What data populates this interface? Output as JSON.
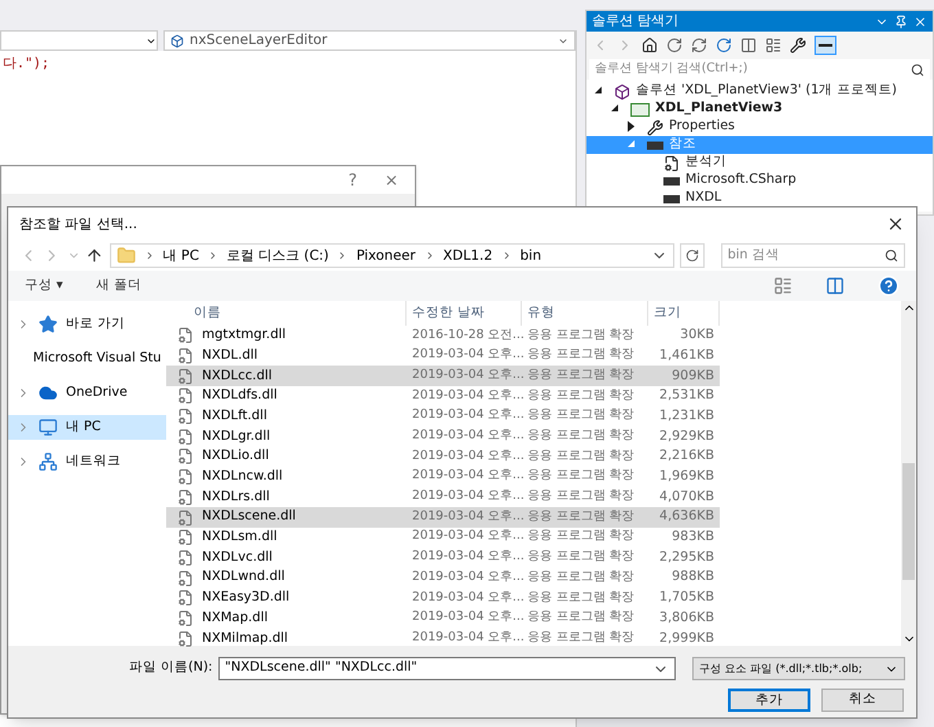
{
  "editor": {
    "member_dropdown": "nxSceneLayerEditor",
    "code_line": "다.\");"
  },
  "back_dialog": {
    "help": "?",
    "close": "×"
  },
  "solution_explorer": {
    "title": "솔루션 탐색기",
    "search": {
      "placeholder": "솔루션 탐색기 검색(Ctrl+;)"
    },
    "tree": [
      {
        "label": "솔루션 'XDL_PlanetView3' (1개 프로젝트)",
        "kind": "solution",
        "expanded": true,
        "selected": false,
        "children": [
          {
            "label": "XDL_PlanetView3",
            "kind": "project",
            "expanded": true,
            "selected": false,
            "children": [
              {
                "label": "Properties",
                "kind": "properties",
                "expanded": false,
                "selected": false
              },
              {
                "label": "참조",
                "kind": "references",
                "expanded": true,
                "selected": true,
                "children": [
                  {
                    "label": "분석기",
                    "kind": "analyzer",
                    "selected": false
                  },
                  {
                    "label": "Microsoft.CSharp",
                    "kind": "reference",
                    "selected": false
                  },
                  {
                    "label": "NXDL",
                    "kind": "reference",
                    "selected": false
                  }
                ]
              }
            ]
          }
        ]
      }
    ]
  },
  "dialog": {
    "title": "참조할 파일 선택...",
    "breadcrumb": [
      "내 PC",
      "로컬 디스크 (C:)",
      "Pixoneer",
      "XDL1.2",
      "bin"
    ],
    "search": {
      "placeholder": "bin 검색"
    },
    "organize": "구성 ▾",
    "new_folder": "새 폴더",
    "nav": [
      {
        "label": "바로 가기",
        "kind": "quick",
        "selected": false
      },
      {
        "label": "Microsoft Visual Stu",
        "kind": "vs",
        "selected": false
      },
      {
        "label": "OneDrive",
        "kind": "cloud",
        "selected": false
      },
      {
        "label": "내 PC",
        "kind": "pc",
        "selected": true
      },
      {
        "label": "네트워크",
        "kind": "network",
        "selected": false
      }
    ],
    "columns": [
      "이름",
      "수정한 날짜",
      "유형",
      "크기"
    ],
    "files": [
      {
        "name": "mgtxtmgr.dll",
        "date": "2016-10-28 오전...",
        "type": "응용 프로그램 확장",
        "size": "30KB",
        "selected": false
      },
      {
        "name": "NXDL.dll",
        "date": "2019-03-04 오후...",
        "type": "응용 프로그램 확장",
        "size": "1,461KB",
        "selected": false
      },
      {
        "name": "NXDLcc.dll",
        "date": "2019-03-04 오후...",
        "type": "응용 프로그램 확장",
        "size": "909KB",
        "selected": true
      },
      {
        "name": "NXDLdfs.dll",
        "date": "2019-03-04 오후...",
        "type": "응용 프로그램 확장",
        "size": "2,531KB",
        "selected": false
      },
      {
        "name": "NXDLft.dll",
        "date": "2019-03-04 오후...",
        "type": "응용 프로그램 확장",
        "size": "1,231KB",
        "selected": false
      },
      {
        "name": "NXDLgr.dll",
        "date": "2019-03-04 오후...",
        "type": "응용 프로그램 확장",
        "size": "2,929KB",
        "selected": false
      },
      {
        "name": "NXDLio.dll",
        "date": "2019-03-04 오후...",
        "type": "응용 프로그램 확장",
        "size": "2,216KB",
        "selected": false
      },
      {
        "name": "NXDLncw.dll",
        "date": "2019-03-04 오후...",
        "type": "응용 프로그램 확장",
        "size": "1,969KB",
        "selected": false
      },
      {
        "name": "NXDLrs.dll",
        "date": "2019-03-04 오후...",
        "type": "응용 프로그램 확장",
        "size": "4,070KB",
        "selected": false
      },
      {
        "name": "NXDLscene.dll",
        "date": "2019-03-04 오후...",
        "type": "응용 프로그램 확장",
        "size": "4,636KB",
        "selected": true
      },
      {
        "name": "NXDLsm.dll",
        "date": "2019-03-04 오후...",
        "type": "응용 프로그램 확장",
        "size": "983KB",
        "selected": false
      },
      {
        "name": "NXDLvc.dll",
        "date": "2019-03-04 오후...",
        "type": "응용 프로그램 확장",
        "size": "2,295KB",
        "selected": false
      },
      {
        "name": "NXDLwnd.dll",
        "date": "2019-03-04 오후...",
        "type": "응용 프로그램 확장",
        "size": "988KB",
        "selected": false
      },
      {
        "name": "NXEasy3D.dll",
        "date": "2019-03-04 오후...",
        "type": "응용 프로그램 확장",
        "size": "1,705KB",
        "selected": false
      },
      {
        "name": "NXMap.dll",
        "date": "2019-03-04 오후...",
        "type": "응용 프로그램 확장",
        "size": "3,806KB",
        "selected": false
      },
      {
        "name": "NXMilmap.dll",
        "date": "2019-03-04 오후...",
        "type": "응용 프로그램 확장",
        "size": "2,999KB",
        "selected": false
      }
    ],
    "filename_label": "파일 이름(N):",
    "filename": "\"NXDLscene.dll\" \"NXDLcc.dll\"",
    "filter": "구성 요소 파일 (*.dll;*.tlb;*.olb;",
    "ok": "추가",
    "cancel": "취소"
  }
}
